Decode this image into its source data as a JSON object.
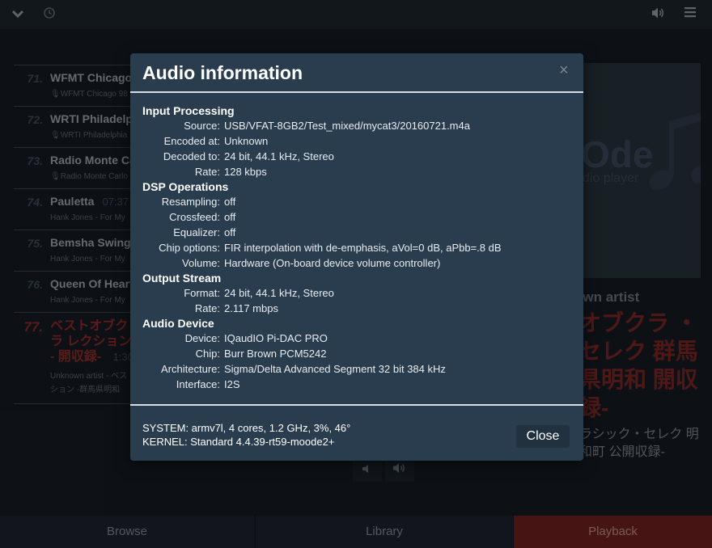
{
  "topbar": {
    "left_icons": [
      "chevron-down-icon",
      "clock-icon"
    ],
    "right_icons": [
      "volume-icon",
      "menu-icon"
    ]
  },
  "playlist": {
    "items": [
      {
        "num": "71.",
        "title": "WFMT Chicago",
        "time": "",
        "sub": "🎙WFMT Chicago 98"
      },
      {
        "num": "72.",
        "title": "WRTI Philadelp",
        "time": "",
        "sub": "🎙WRTI Philadelphia"
      },
      {
        "num": "73.",
        "title": "Radio Monte Ca",
        "time": "",
        "sub": "🎙Radio Monte Carlo"
      },
      {
        "num": "74.",
        "title": "Pauletta",
        "time": "07:37",
        "sub": "Hank Jones - For My"
      },
      {
        "num": "75.",
        "title": "Bemsha Swing",
        "time": "",
        "sub": "Hank Jones - For My"
      },
      {
        "num": "76.",
        "title": "Queen Of Heart",
        "time": "",
        "sub": "Hank Jones - For My"
      }
    ],
    "current": {
      "num": "77.",
      "title": "ベストオブクラ レクション - 開収録-",
      "time": "1:30",
      "sub": "Unknown artist - ベス クション -群馬県明和"
    }
  },
  "cover": {
    "logo": "Ode",
    "sub": "dio player",
    "note": "♫"
  },
  "now_playing": {
    "artist": "own artist",
    "title": "オブクラ ・セレク 群馬県明和 開収録-",
    "album": "ラシック・セレク 明和町 公開収録-"
  },
  "volume": {
    "down_icon": "volume-down-icon",
    "up_icon": "volume-up-icon"
  },
  "tabs": {
    "browse": "Browse",
    "library": "Library",
    "playback": "Playback"
  },
  "modal": {
    "title": "Audio information",
    "close_x": "×",
    "sections": [
      {
        "heading": "Input Processing",
        "rows": [
          {
            "label": "Source:",
            "value": "USB/VFAT-8GB2/Test_mixed/mycat3/20160721.m4a"
          },
          {
            "label": "Encoded at:",
            "value": "Unknown"
          },
          {
            "label": "Decoded to:",
            "value": "24 bit, 44.1 kHz, Stereo"
          },
          {
            "label": "Rate:",
            "value": "128 kbps"
          }
        ]
      },
      {
        "heading": "DSP Operations",
        "rows": [
          {
            "label": "Resampling:",
            "value": "off"
          },
          {
            "label": "Crossfeed:",
            "value": "off"
          },
          {
            "label": "Equalizer:",
            "value": "off"
          },
          {
            "label": "Chip options:",
            "value": "FIR interpolation with de-emphasis, aVol=0 dB, aPbb=.8 dB"
          },
          {
            "label": "Volume:",
            "value": "Hardware (On-board device volume controller)"
          }
        ]
      },
      {
        "heading": "Output Stream",
        "rows": [
          {
            "label": "Format:",
            "value": "24 bit, 44.1 kHz, Stereo"
          },
          {
            "label": "Rate:",
            "value": "2.117 mbps"
          }
        ]
      },
      {
        "heading": "Audio Device",
        "rows": [
          {
            "label": "Device:",
            "value": "IQaudIO Pi-DAC PRO"
          },
          {
            "label": "Chip:",
            "value": "Burr Brown PCM5242"
          },
          {
            "label": "Architecture:",
            "value": "Sigma/Delta Advanced Segment 32 bit 384 kHz"
          },
          {
            "label": "Interface:",
            "value": "I2S"
          }
        ]
      }
    ],
    "system": "SYSTEM: armv7l, 4 cores, 1.2 GHz, 3%, 46°",
    "kernel": "KERNEL: Standard 4.4.39-rt59-moode2+",
    "close_button": "Close"
  }
}
